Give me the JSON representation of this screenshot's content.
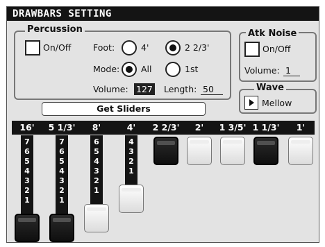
{
  "window": {
    "title": "DRAWBARS SETTING"
  },
  "percussion": {
    "legend": "Percussion",
    "onoff_label": "On/Off",
    "foot_label": "Foot:",
    "foot_options": [
      "4'",
      "2 2/3'"
    ],
    "foot_selected": "2 2/3'",
    "mode_label": "Mode:",
    "mode_options": [
      "All",
      "1st"
    ],
    "mode_selected": "All",
    "volume_label": "Volume:",
    "volume_value": "127",
    "length_label": "Length:",
    "length_value": "50"
  },
  "atk_noise": {
    "legend": "Atk Noise",
    "onoff_label": "On/Off",
    "volume_label": "Volume:",
    "volume_value": "1"
  },
  "wave": {
    "legend": "Wave",
    "value": "Mellow"
  },
  "get_sliders_button": "Get Sliders",
  "drawbars": [
    {
      "foot": "16'",
      "level": 8,
      "cap": "dark",
      "numbers": [
        "7",
        "6",
        "5",
        "4",
        "3",
        "2",
        "1"
      ]
    },
    {
      "foot": "5 1/3'",
      "level": 8,
      "cap": "dark",
      "numbers": [
        "7",
        "6",
        "5",
        "4",
        "3",
        "2",
        "1"
      ]
    },
    {
      "foot": "8'",
      "level": 7,
      "cap": "light",
      "numbers": [
        "6",
        "5",
        "4",
        "3",
        "2",
        "1"
      ]
    },
    {
      "foot": "4'",
      "level": 5,
      "cap": "light",
      "numbers": [
        "4",
        "3",
        "2",
        "1"
      ]
    },
    {
      "foot": "2 2/3'",
      "level": 0,
      "cap": "dark",
      "numbers": []
    },
    {
      "foot": "2'",
      "level": 0,
      "cap": "light",
      "numbers": []
    },
    {
      "foot": "1 3/5'",
      "level": 0,
      "cap": "light",
      "numbers": []
    },
    {
      "foot": "1 1/3'",
      "level": 0,
      "cap": "dark",
      "numbers": []
    },
    {
      "foot": "1'",
      "level": 0,
      "cap": "light",
      "numbers": []
    }
  ]
}
